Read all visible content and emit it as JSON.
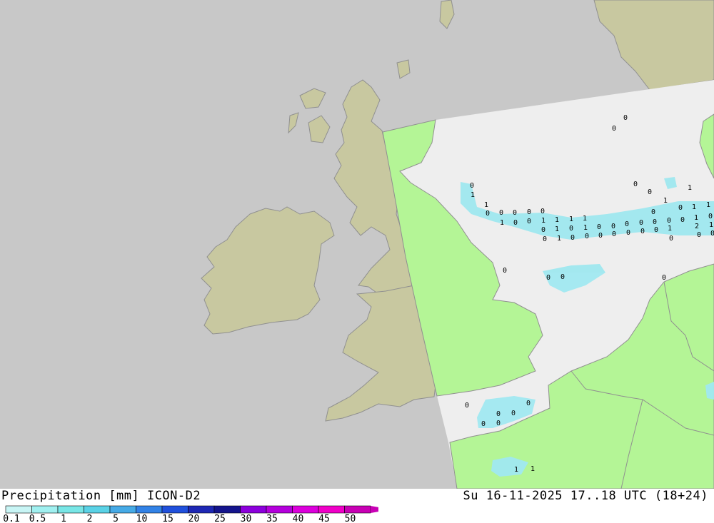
{
  "header": {
    "product_label": "Precipitation [mm] ICON-D2",
    "valid_time_label": "Su 16-11-2025 17..18 UTC (18+24)"
  },
  "legend": {
    "levels": [
      "0.1",
      "0.5",
      "1",
      "2",
      "5",
      "10",
      "15",
      "20",
      "25",
      "30",
      "35",
      "40",
      "45",
      "50"
    ],
    "colors": [
      "#c8f5f5",
      "#a0f0f0",
      "#78e6e6",
      "#5ad2e6",
      "#46aae6",
      "#3282e6",
      "#2050dc",
      "#1e28b4",
      "#14148c",
      "#8c00dc",
      "#b400dc",
      "#dc00dc",
      "#f000c8",
      "#c800b4"
    ]
  },
  "map_colors": {
    "sea_outside_domain": "#c8c8c8",
    "land_outside_domain": "#c8c8a0",
    "sea_in_domain": "#eeeeee",
    "land_in_domain": "#b4f596",
    "coastline": "#909090",
    "precip_light": "#a0e8f0"
  },
  "cell_values": [
    "0",
    "0",
    "0",
    "1",
    "1",
    "0",
    "0",
    "0",
    "0",
    "0",
    "0",
    "0",
    "1",
    "1",
    "0",
    "1",
    "1",
    "0",
    "1",
    "0",
    "0",
    "1",
    "1",
    "1",
    "1",
    "0",
    "1",
    "0",
    "1",
    "0",
    "0",
    "0",
    "0",
    "0",
    "0",
    "0",
    "1",
    "0",
    "0",
    "1",
    "0",
    "0",
    "0",
    "0",
    "0",
    "0",
    "0",
    "1",
    "2",
    "1",
    "0",
    "0",
    "0",
    "0",
    "0",
    "0",
    "0",
    "0",
    "0",
    "0",
    "0",
    "0",
    "0",
    "1",
    "1"
  ]
}
